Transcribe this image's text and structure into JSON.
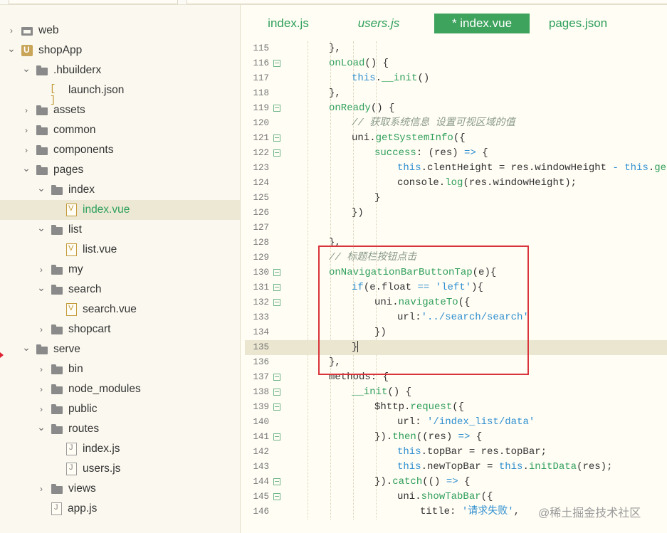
{
  "sidebar": {
    "items": [
      {
        "label": "web",
        "indent": 0,
        "arrow": "›",
        "icon": "web-folder-icon",
        "kind": "webfolder"
      },
      {
        "label": "shopApp",
        "indent": 0,
        "arrow": "⌄",
        "icon": "project-icon",
        "kind": "project"
      },
      {
        "label": ".hbuilderx",
        "indent": 1,
        "arrow": "⌄",
        "icon": "folder-icon",
        "kind": "folder"
      },
      {
        "label": "launch.json",
        "indent": 2,
        "arrow": "",
        "icon": "json-file-icon",
        "kind": "json"
      },
      {
        "label": "assets",
        "indent": 1,
        "arrow": "›",
        "icon": "folder-icon",
        "kind": "folder"
      },
      {
        "label": "common",
        "indent": 1,
        "arrow": "›",
        "icon": "folder-icon",
        "kind": "folder"
      },
      {
        "label": "components",
        "indent": 1,
        "arrow": "›",
        "icon": "folder-icon",
        "kind": "folder"
      },
      {
        "label": "pages",
        "indent": 1,
        "arrow": "⌄",
        "icon": "folder-icon",
        "kind": "folder"
      },
      {
        "label": "index",
        "indent": 2,
        "arrow": "⌄",
        "icon": "folder-icon",
        "kind": "folder"
      },
      {
        "label": "index.vue",
        "indent": 3,
        "arrow": "",
        "icon": "vue-file-icon",
        "kind": "vue",
        "selected": true
      },
      {
        "label": "list",
        "indent": 2,
        "arrow": "⌄",
        "icon": "folder-icon",
        "kind": "folder"
      },
      {
        "label": "list.vue",
        "indent": 3,
        "arrow": "",
        "icon": "vue-file-icon",
        "kind": "vue"
      },
      {
        "label": "my",
        "indent": 2,
        "arrow": "›",
        "icon": "folder-icon",
        "kind": "folder"
      },
      {
        "label": "search",
        "indent": 2,
        "arrow": "⌄",
        "icon": "folder-icon",
        "kind": "folder"
      },
      {
        "label": "search.vue",
        "indent": 3,
        "arrow": "",
        "icon": "vue-file-icon",
        "kind": "vue"
      },
      {
        "label": "shopcart",
        "indent": 2,
        "arrow": "›",
        "icon": "folder-icon",
        "kind": "folder"
      },
      {
        "label": "serve",
        "indent": 1,
        "arrow": "⌄",
        "icon": "folder-icon",
        "kind": "folder"
      },
      {
        "label": "bin",
        "indent": 2,
        "arrow": "›",
        "icon": "folder-icon",
        "kind": "folder"
      },
      {
        "label": "node_modules",
        "indent": 2,
        "arrow": "›",
        "icon": "folder-icon",
        "kind": "folder"
      },
      {
        "label": "public",
        "indent": 2,
        "arrow": "›",
        "icon": "folder-icon",
        "kind": "folder"
      },
      {
        "label": "routes",
        "indent": 2,
        "arrow": "⌄",
        "icon": "folder-icon",
        "kind": "folder"
      },
      {
        "label": "index.js",
        "indent": 3,
        "arrow": "",
        "icon": "js-file-icon",
        "kind": "js"
      },
      {
        "label": "users.js",
        "indent": 3,
        "arrow": "",
        "icon": "js-file-icon",
        "kind": "js"
      },
      {
        "label": "views",
        "indent": 2,
        "arrow": "›",
        "icon": "folder-icon",
        "kind": "folder"
      },
      {
        "label": "app.js",
        "indent": 2,
        "arrow": "",
        "icon": "js-file-icon",
        "kind": "js"
      }
    ]
  },
  "tabs": [
    {
      "label": "index.js",
      "italic": false,
      "active": false
    },
    {
      "label": "users.js",
      "italic": true,
      "active": false
    },
    {
      "label": "* index.vue",
      "italic": false,
      "active": true
    },
    {
      "label": "pages.json",
      "italic": false,
      "active": false
    }
  ],
  "code": [
    {
      "n": "115",
      "fold": false,
      "indent": 2,
      "tokens": [
        [
          "",
          "},"
        ]
      ]
    },
    {
      "n": "116",
      "fold": true,
      "indent": 2,
      "tokens": [
        [
          "fn",
          "onLoad"
        ],
        [
          "",
          "() {"
        ]
      ]
    },
    {
      "n": "117",
      "fold": false,
      "indent": 3,
      "tokens": [
        [
          "kw",
          "this"
        ],
        [
          "",
          "."
        ],
        [
          "fn",
          "__init"
        ],
        [
          "",
          "()"
        ]
      ]
    },
    {
      "n": "118",
      "fold": false,
      "indent": 2,
      "tokens": [
        [
          "",
          "},"
        ]
      ]
    },
    {
      "n": "119",
      "fold": true,
      "indent": 2,
      "tokens": [
        [
          "fn",
          "onReady"
        ],
        [
          "",
          "() {"
        ]
      ]
    },
    {
      "n": "120",
      "fold": false,
      "indent": 3,
      "tokens": [
        [
          "cm",
          "// 获取系统信息 设置可视区域的值"
        ]
      ]
    },
    {
      "n": "121",
      "fold": true,
      "indent": 3,
      "tokens": [
        [
          "",
          "uni."
        ],
        [
          "fn",
          "getSystemInfo"
        ],
        [
          "",
          "({"
        ]
      ]
    },
    {
      "n": "122",
      "fold": true,
      "indent": 4,
      "tokens": [
        [
          "fn",
          "success"
        ],
        [
          "",
          ": (res) "
        ],
        [
          "kw",
          "=>"
        ],
        [
          "",
          " {"
        ]
      ]
    },
    {
      "n": "123",
      "fold": false,
      "indent": 5,
      "tokens": [
        [
          "kw",
          "this"
        ],
        [
          "",
          ".clentHeight = res.windowHeight "
        ],
        [
          "kw",
          "-"
        ],
        [
          "",
          " "
        ],
        [
          "kw",
          "this"
        ],
        [
          "",
          "."
        ],
        [
          "fn",
          "getCl"
        ]
      ]
    },
    {
      "n": "124",
      "fold": false,
      "indent": 5,
      "tokens": [
        [
          "",
          "console."
        ],
        [
          "fn",
          "log"
        ],
        [
          "",
          "(res.windowHeight);"
        ]
      ]
    },
    {
      "n": "125",
      "fold": false,
      "indent": 4,
      "tokens": [
        [
          "",
          "}"
        ]
      ]
    },
    {
      "n": "126",
      "fold": false,
      "indent": 3,
      "tokens": [
        [
          "",
          "})"
        ]
      ]
    },
    {
      "n": "127",
      "fold": false,
      "indent": 2,
      "tokens": [
        [
          "",
          ""
        ]
      ]
    },
    {
      "n": "128",
      "fold": false,
      "indent": 2,
      "tokens": [
        [
          "",
          "},"
        ]
      ]
    },
    {
      "n": "129",
      "fold": false,
      "indent": 2,
      "tokens": [
        [
          "cm",
          "// 标题栏按钮点击"
        ]
      ]
    },
    {
      "n": "130",
      "fold": true,
      "indent": 2,
      "tokens": [
        [
          "fn",
          "onNavigationBarButtonTap"
        ],
        [
          "",
          "(e){"
        ]
      ]
    },
    {
      "n": "131",
      "fold": true,
      "indent": 3,
      "tokens": [
        [
          "kw",
          "if"
        ],
        [
          "",
          "(e.float "
        ],
        [
          "kw",
          "=="
        ],
        [
          "",
          " "
        ],
        [
          "st",
          "'left'"
        ],
        [
          "",
          "){"
        ]
      ]
    },
    {
      "n": "132",
      "fold": true,
      "indent": 4,
      "tokens": [
        [
          "",
          "uni."
        ],
        [
          "fn",
          "navigateTo"
        ],
        [
          "",
          "({"
        ]
      ]
    },
    {
      "n": "133",
      "fold": false,
      "indent": 5,
      "tokens": [
        [
          "",
          "url:"
        ],
        [
          "st",
          "'../search/search'"
        ]
      ]
    },
    {
      "n": "134",
      "fold": false,
      "indent": 4,
      "tokens": [
        [
          "",
          "})"
        ]
      ]
    },
    {
      "n": "135",
      "fold": false,
      "indent": 3,
      "tokens": [
        [
          "",
          "}"
        ]
      ],
      "highlight": true,
      "caret": true
    },
    {
      "n": "136",
      "fold": false,
      "indent": 2,
      "tokens": [
        [
          "",
          "},"
        ]
      ]
    },
    {
      "n": "137",
      "fold": true,
      "indent": 2,
      "tokens": [
        [
          "",
          "methods: {"
        ]
      ]
    },
    {
      "n": "138",
      "fold": true,
      "indent": 3,
      "tokens": [
        [
          "fn",
          "__init"
        ],
        [
          "",
          "() {"
        ]
      ]
    },
    {
      "n": "139",
      "fold": true,
      "indent": 4,
      "tokens": [
        [
          "",
          "$http."
        ],
        [
          "fn",
          "request"
        ],
        [
          "",
          "({"
        ]
      ]
    },
    {
      "n": "140",
      "fold": false,
      "indent": 5,
      "tokens": [
        [
          "",
          "url: "
        ],
        [
          "st",
          "'/index_list/data'"
        ]
      ]
    },
    {
      "n": "141",
      "fold": true,
      "indent": 4,
      "tokens": [
        [
          "",
          "})."
        ],
        [
          "fn",
          "then"
        ],
        [
          "",
          "((res) "
        ],
        [
          "kw",
          "=>"
        ],
        [
          "",
          " {"
        ]
      ]
    },
    {
      "n": "142",
      "fold": false,
      "indent": 5,
      "tokens": [
        [
          "kw",
          "this"
        ],
        [
          "",
          ".topBar = res.topBar;"
        ]
      ]
    },
    {
      "n": "143",
      "fold": false,
      "indent": 5,
      "tokens": [
        [
          "kw",
          "this"
        ],
        [
          "",
          ".newTopBar = "
        ],
        [
          "kw",
          "this"
        ],
        [
          "",
          "."
        ],
        [
          "fn",
          "initData"
        ],
        [
          "",
          "(res);"
        ]
      ]
    },
    {
      "n": "144",
      "fold": true,
      "indent": 4,
      "tokens": [
        [
          "",
          "})."
        ],
        [
          "fn",
          "catch"
        ],
        [
          "",
          "(() "
        ],
        [
          "kw",
          "=>"
        ],
        [
          "",
          " {"
        ]
      ]
    },
    {
      "n": "145",
      "fold": true,
      "indent": 5,
      "tokens": [
        [
          "",
          "uni."
        ],
        [
          "fn",
          "showTabBar"
        ],
        [
          "",
          "({"
        ]
      ]
    },
    {
      "n": "146",
      "fold": false,
      "indent": 6,
      "tokens": [
        [
          "",
          "title: "
        ],
        [
          "st",
          "'请求失败'"
        ],
        [
          "",
          ","
        ]
      ]
    }
  ],
  "watermark": "@稀土掘金技术社区"
}
